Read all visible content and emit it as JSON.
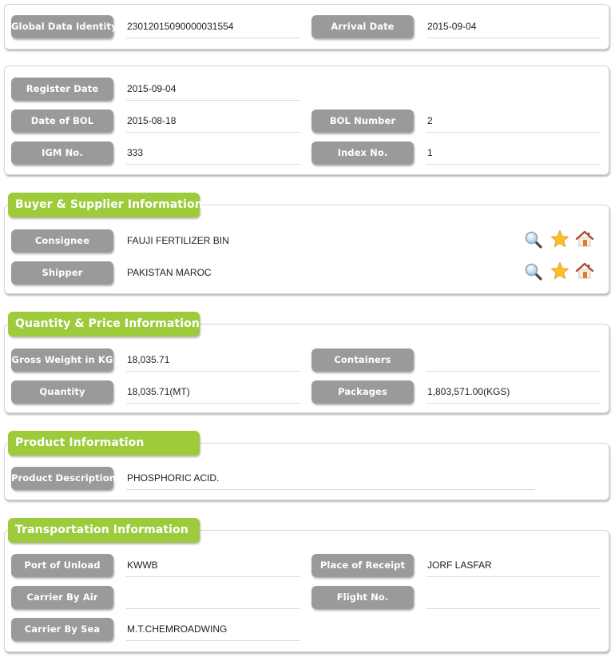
{
  "identity": {
    "global_data_identity": {
      "label": "Global Data Identity",
      "value": "23012015090000031554"
    },
    "arrival_date": {
      "label": "Arrival Date",
      "value": "2015-09-04"
    }
  },
  "bol": {
    "register_date": {
      "label": "Register Date",
      "value": "2015-09-04"
    },
    "date_of_bol": {
      "label": "Date of BOL",
      "value": "2015-08-18"
    },
    "bol_number": {
      "label": "BOL Number",
      "value": "2"
    },
    "igm_no": {
      "label": "IGM No.",
      "value": "333"
    },
    "index_no": {
      "label": "Index No.",
      "value": "1"
    }
  },
  "buyer_supplier": {
    "title": "Buyer & Supplier Information",
    "consignee": {
      "label": "Consignee",
      "value": "FAUJI FERTILIZER BIN"
    },
    "shipper": {
      "label": "Shipper",
      "value": "PAKISTAN MAROC"
    },
    "action_icons": [
      "search-icon",
      "star-icon",
      "home-icon"
    ]
  },
  "quantity_price": {
    "title": "Quantity & Price Information",
    "gross_weight": {
      "label": "Gross Weight in KG",
      "value": "18,035.71"
    },
    "containers": {
      "label": "Containers",
      "value": ""
    },
    "quantity": {
      "label": "Quantity",
      "value": "18,035.71(MT)"
    },
    "packages": {
      "label": "Packages",
      "value": "1,803,571.00(KGS)"
    }
  },
  "product": {
    "title": "Product Information",
    "description": {
      "label": "Product Description",
      "value": "PHOSPHORIC ACID."
    }
  },
  "transportation": {
    "title": "Transportation Information",
    "port_of_unload": {
      "label": "Port of Unload",
      "value": "KWWB"
    },
    "place_of_receipt": {
      "label": "Place of Receipt",
      "value": "JORF LASFAR"
    },
    "carrier_by_air": {
      "label": "Carrier By Air",
      "value": ""
    },
    "flight_no": {
      "label": "Flight No.",
      "value": ""
    },
    "carrier_by_sea": {
      "label": "Carrier By Sea",
      "value": "M.T.CHEMROADWING"
    }
  },
  "colors": {
    "section_accent": "#9dcb3c",
    "label_background": "#9a9a9a"
  }
}
